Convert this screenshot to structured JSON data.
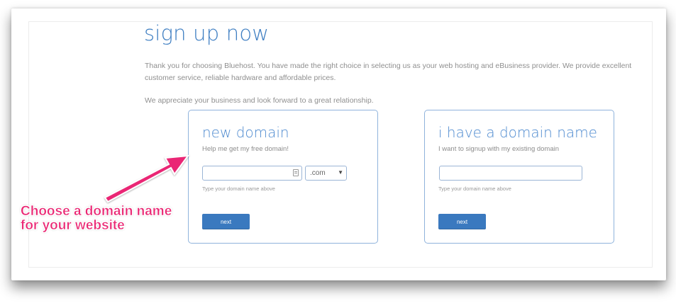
{
  "page": {
    "title": "sign up now",
    "intro": "Thank you for choosing Bluehost. You have made the right choice in selecting us as your web hosting and eBusiness provider. We provide excellent customer service, reliable hardware and affordable prices.",
    "appreciation": "We appreciate your business and look forward to a great relationship."
  },
  "new_domain": {
    "title": "new domain",
    "subtitle": "Help me get my free domain!",
    "input_value": "",
    "tld_selected": ".com",
    "helper": "Type your domain name above",
    "next_label": "next"
  },
  "existing_domain": {
    "title": "i have a domain name",
    "subtitle": "I want to signup with my existing domain",
    "input_value": "",
    "helper": "Type your domain name above",
    "next_label": "next"
  },
  "annotation": {
    "line1": "Choose a domain name",
    "line2": "for your website"
  },
  "colors": {
    "accent": "#3e7ec2",
    "button": "#3a79bf",
    "annotation": "#ea2874",
    "box_border": "#8fb3dc"
  },
  "icons": {
    "field": "list-icon",
    "dropdown": "chevron-down-icon",
    "annotation_arrow": "arrow-icon"
  }
}
